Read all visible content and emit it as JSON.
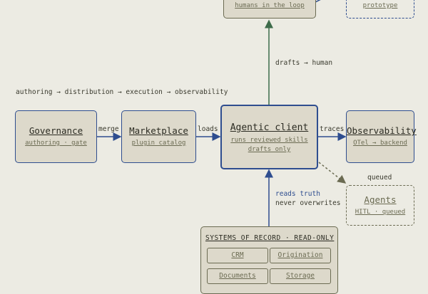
{
  "pipeline_caption": "authoring → distribution → execution → observability",
  "top_node": {
    "sub": "humans in the loop"
  },
  "prototype_node": {
    "sub": "prototype"
  },
  "governance": {
    "title": "Governance",
    "sub": "authoring · gate"
  },
  "marketplace": {
    "title": "Marketplace",
    "sub": "plugin catalog"
  },
  "agentic_client": {
    "title": "Agentic client",
    "sub1": "runs reviewed skills",
    "sub2": "drafts only"
  },
  "observability": {
    "title": "Observability",
    "sub": "OTel → backend"
  },
  "agents": {
    "title": "Agents",
    "sub": "HITL · queued"
  },
  "edges": {
    "merge": "merge",
    "loads": "loads",
    "traces": "traces",
    "drafts_human": "drafts → human",
    "queued": "queued",
    "reads_truth": "reads truth",
    "never_overwrites": "never overwrites"
  },
  "systems_of_record": {
    "title": "SYSTEMS OF RECORD · READ-ONLY",
    "items": [
      "CRM",
      "Origination",
      "Documents",
      "Storage"
    ]
  },
  "colors": {
    "background": "#ecebe3",
    "node_fill": "#ddd9cb",
    "blue": "#2e4d8f",
    "green": "#3d6b4a",
    "grey": "#6b6b52"
  }
}
